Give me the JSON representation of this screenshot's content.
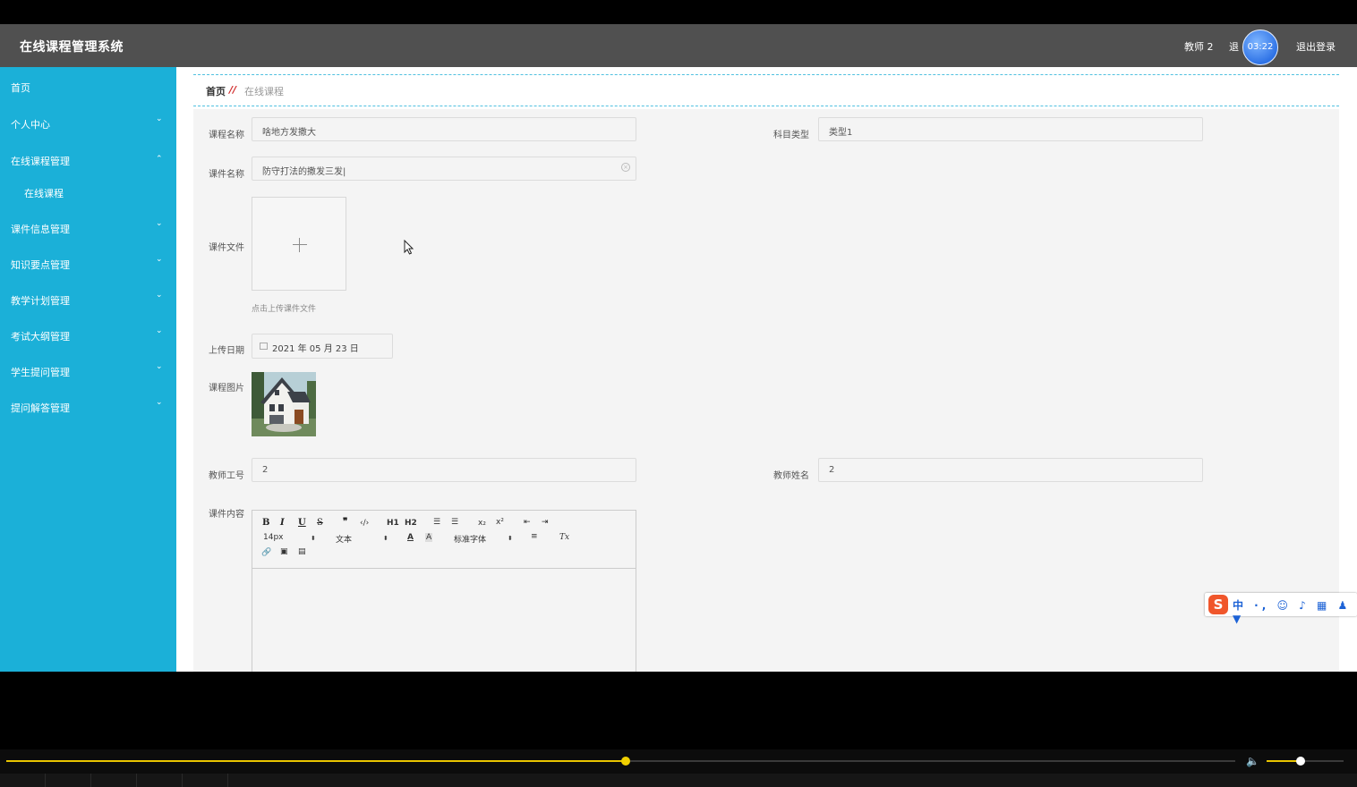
{
  "header": {
    "app_title": "在线课程管理系统",
    "user": "教师 2",
    "back_label": "退",
    "timer": "03:22",
    "logout": "退出登录"
  },
  "sidebar": {
    "items": [
      {
        "label": "首页",
        "chevron": ""
      },
      {
        "label": "个人中心",
        "chevron": "⌄"
      },
      {
        "label": "在线课程管理",
        "chevron": "⌃"
      },
      {
        "label": "在线课程",
        "chevron": ""
      },
      {
        "label": "课件信息管理",
        "chevron": "⌄"
      },
      {
        "label": "知识要点管理",
        "chevron": "⌄"
      },
      {
        "label": "教学计划管理",
        "chevron": "⌄"
      },
      {
        "label": "考试大纲管理",
        "chevron": "⌄"
      },
      {
        "label": "学生提问管理",
        "chevron": "⌄"
      },
      {
        "label": "提问解答管理",
        "chevron": "⌄"
      }
    ]
  },
  "breadcrumb": {
    "home": "首页",
    "sep": "//",
    "current": "在线课程"
  },
  "form": {
    "course_name_label": "课程名称",
    "course_name_value": "啥地方发撒大",
    "subject_type_label": "科目类型",
    "subject_type_value": "类型1",
    "courseware_name_label": "课件名称",
    "courseware_name_value": "防守打法的撒发三发|",
    "courseware_file_label": "课件文件",
    "upload_hint": "点击上传课件文件",
    "upload_date_label": "上传日期",
    "upload_date_value": "2021 年 05 月 23 日",
    "course_image_label": "课程图片",
    "teacher_id_label": "教师工号",
    "teacher_id_value": "2",
    "teacher_name_label": "教师姓名",
    "teacher_name_value": "2",
    "content_label": "课件内容"
  },
  "editor": {
    "bold": "B",
    "italic": "I",
    "underline": "U",
    "strike": "S",
    "quote": "❞",
    "code": "‹/›",
    "h1": "H1",
    "h2": "H2",
    "ol": "☰",
    "ul": "☰",
    "sub": "x₂",
    "sup": "x²",
    "outdent": "⇤",
    "indent": "⇥",
    "size": "14px",
    "para": "文本",
    "font_color": "A",
    "bg_color": "A",
    "font": "标准字体",
    "align": "≡",
    "clear": "Tx",
    "link": "🔗",
    "image": "▣",
    "video": "▤"
  },
  "ime": {
    "logo": "S",
    "text": "中 ·, ☺ ♪ ▦ ♟ ▼"
  },
  "player": {
    "progress": 0.504,
    "volume": 0.44
  }
}
